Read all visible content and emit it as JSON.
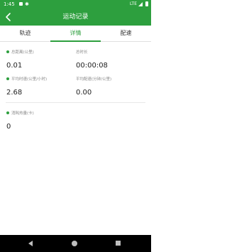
{
  "status_bar": {
    "time": "1:45",
    "network": "LTE"
  },
  "app_bar": {
    "title": "运动记录",
    "back_icon": "arrow-back-icon"
  },
  "tabs": [
    {
      "label": "轨迹",
      "active": false
    },
    {
      "label": "详情",
      "active": true
    },
    {
      "label": "配速",
      "active": false
    }
  ],
  "stats": {
    "total_distance": {
      "label": "总距离(公里)",
      "value": "0.01"
    },
    "total_duration": {
      "label": "总时长",
      "value": "00:00:08"
    },
    "avg_speed": {
      "label": "平均时速(公里/小时)",
      "value": "2.68"
    },
    "avg_pace": {
      "label": "平均配速(分钟/公里)",
      "value": "0.00"
    },
    "calories": {
      "label": "消耗热量(卡)",
      "value": "0"
    }
  },
  "colors": {
    "primary": "#2d9f3e",
    "nav_bar": "#000000"
  },
  "nav_bar": {
    "icons": [
      "nav-back-icon",
      "nav-home-icon",
      "nav-recents-icon"
    ]
  }
}
